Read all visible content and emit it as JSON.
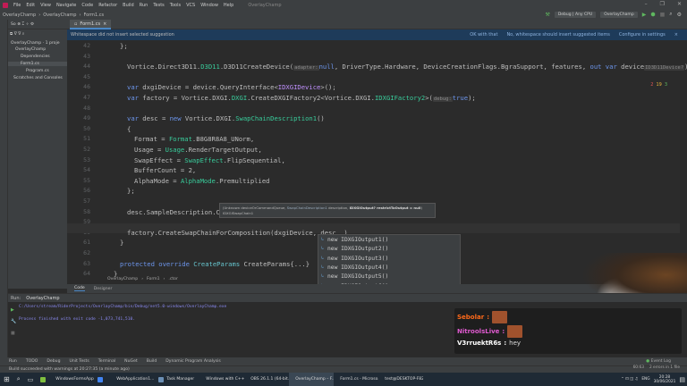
{
  "menu": {
    "items": [
      "File",
      "Edit",
      "View",
      "Navigate",
      "Code",
      "Refactor",
      "Build",
      "Run",
      "Tests",
      "Tools",
      "VCS",
      "Window",
      "Help"
    ],
    "app_title": "OverlayChamp"
  },
  "nav": {
    "crumbs": [
      "OverlayChamp",
      "OverlayChamp",
      "Form1.cs"
    ]
  },
  "run_config": {
    "build": "Debug | Any CPU",
    "project": "OverlayChamp"
  },
  "file_tab": "Form1.cs",
  "notification": {
    "text": "Whitespace did not insert selected suggestion",
    "actions": [
      "OK with that",
      "No, whitespace should insert suggested items",
      "Configure in settings"
    ]
  },
  "inspections": {
    "errors": "2",
    "warnings": "19",
    "ok": "3"
  },
  "project": {
    "items": [
      "OverlayChamp · 1 proje",
      "OverlayChamp",
      "Dependencies",
      "Form1.cs",
      "Program.cs",
      "Scratches and Consoles"
    ],
    "toolbar": "So"
  },
  "editor": {
    "line_numbers": [
      "42",
      "43",
      "44",
      "45",
      "46",
      "47",
      "48",
      "49",
      "50",
      "51",
      "52",
      "53",
      "54",
      "55",
      "56",
      "57",
      "58",
      "59",
      "60",
      "61",
      "62",
      "63",
      "64"
    ],
    "lines": {
      "l42": "};",
      "l44a": "Vortice.Direct3D11.",
      "l44b": "D3D11",
      ".l44c": "",
      "l44c": ".D3D11CreateDevice(",
      "l44h": "adapter:",
      "l44d": "null",
      "l44e": ", DriverType.Hardware, DeviceCreationFlags.BgraSupport, features, ",
      "l44f": "out var",
      " l44g": "",
      "l44g": " device",
      "l44h2": "ID3D11Device?",
      "l44i": ");",
      "l46a": "var",
      " l46b": "",
      "l46b": " dxgiDevice = device.QueryInterface<",
      "l46c": "IDXGIDevice",
      "l46d": ">();",
      "l47a": "var",
      "l47b": " factory = Vortice.DXGI.",
      "l47c": "DXGI",
      "l47d": ".CreateDXGIFactory2<Vortice.DXGI.",
      "l47e": "IDXGIFactory2",
      "l47f": ">(",
      "l47h": "debug:",
      "l47g": "true",
      ");": "",
      "l47i": ");",
      "l49a": "var",
      "l49b": " desc = ",
      "l49c": "new",
      "l49d": " Vortice.DXGI.",
      "l49e": "SwapChainDescription1",
      "l49f": "()",
      "l50": "{",
      "l51a": "Format = ",
      "l51b": "Format",
      ".": "",
      "l51c": ".B8G8R8A8_UNorm,",
      "l52a": "Usage = ",
      "l52b": "Usage",
      "l52c": ".RenderTargetOutput,",
      "l53a": "SwapEffect = ",
      "l53b": "SwapEffect",
      "l53c": ".FlipSequential,",
      "l54": "BufferCount = 2,",
      "l55a": "AlphaMode = ",
      "l55b": "AlphaMode",
      "l55c": ".Premultiplied",
      "l56": "};",
      "l58": "desc.SampleDescription.Cou",
      "l60": "factory.CreateSwapChainForComposition(dxgiDevice, desc, )",
      "l61": "}",
      "l63a": "protected override",
      "l63b": " CreateParams",
      " l63c": "",
      "l63c": " CreateParams",
      "l63d": "{...}",
      "l64": "}"
    }
  },
  "tooltip": {
    "text1": "(Unknown deviceOrCommandQueue, ",
    "text2": "SwapChainDescription1",
    "text3": " description, ",
    "text4": "IDXGIOutput? restrictToOutput = null",
    "text5": ") IDXGISwapChain1"
  },
  "completion": {
    "items": [
      {
        "label": "new IDXGIOutput1()",
        "type": ""
      },
      {
        "label": "new IDXGIOutput2()",
        "type": ""
      },
      {
        "label": "new IDXGIOutput3()",
        "type": ""
      },
      {
        "label": "new IDXGIOutput4()",
        "type": ""
      },
      {
        "label": "new IDXGIOutput5()",
        "type": ""
      },
      {
        "label": "new IDXGIOutput6()",
        "type": ""
      },
      {
        "label": "new IDXGIOutput?()",
        "type": ""
      },
      {
        "label": "null",
        "type": ""
      },
      {
        "label": "desc",
        "type": "SwapChainDescription1"
      },
      {
        "label": "device",
        "type": "ID3D11Device?"
      },
      {
        "label": "factory",
        "type": "IDXGIFactory2"
      },
      {
        "label": "features",
        "type": "FeatureLevel[]"
      }
    ],
    "footer": "Press Enter to insert, Tab to replace",
    "tip": "Next Tip"
  },
  "editor_breadcrumb": [
    "OverlayChamp",
    "Form1",
    ".ctor"
  ],
  "bottom_tabs": [
    "Code",
    "Designer"
  ],
  "run": {
    "label": "Run:",
    "tab": "OverlayChamp",
    "output": [
      "C:/Users/stream/RiderProjects/OverlayChamp/bin/Debug/net5.0-windows/OverlayChamp.exe",
      "Process finished with exit code -1,073,741,510."
    ]
  },
  "tool_windows": [
    "Run",
    "TODO",
    "Debug",
    "Unit Tests",
    "Terminal",
    "NuGet",
    "Build",
    "Dynamic Program Analysis"
  ],
  "status": {
    "text": "Build succeeded with warnings at 20:27:35 (a minute ago)",
    "position": "60:63",
    "errors": "2 errors in 1 file",
    "event_log": "Event Log"
  },
  "chat": [
    {
      "user": "Sebolar",
      "color": "#ff6a1a",
      "text": ""
    },
    {
      "user": "NitroolsLive",
      "color": "#e05ad0",
      "text": ""
    },
    {
      "user": "V3rruektR6s",
      "color": "#ffffff",
      "text": "hey"
    }
  ],
  "taskbar": {
    "apps": [
      "WindowsFormsApp2",
      "",
      "WebApplication1...",
      "Task Manager",
      "Windows with C++...",
      "OBS 26.1.1 (64-bit...",
      "OverlayChamp – F...",
      "Form1.cs - Microso...",
      "test@DESKTOP-F82..."
    ],
    "lang": "ENG",
    "time": "20:28",
    "date": "30/06/2021"
  },
  "colors": {
    "accent": "#4a88c7",
    "error": "#e05555",
    "warning": "#e8b43a",
    "ok": "#5fb85f"
  }
}
